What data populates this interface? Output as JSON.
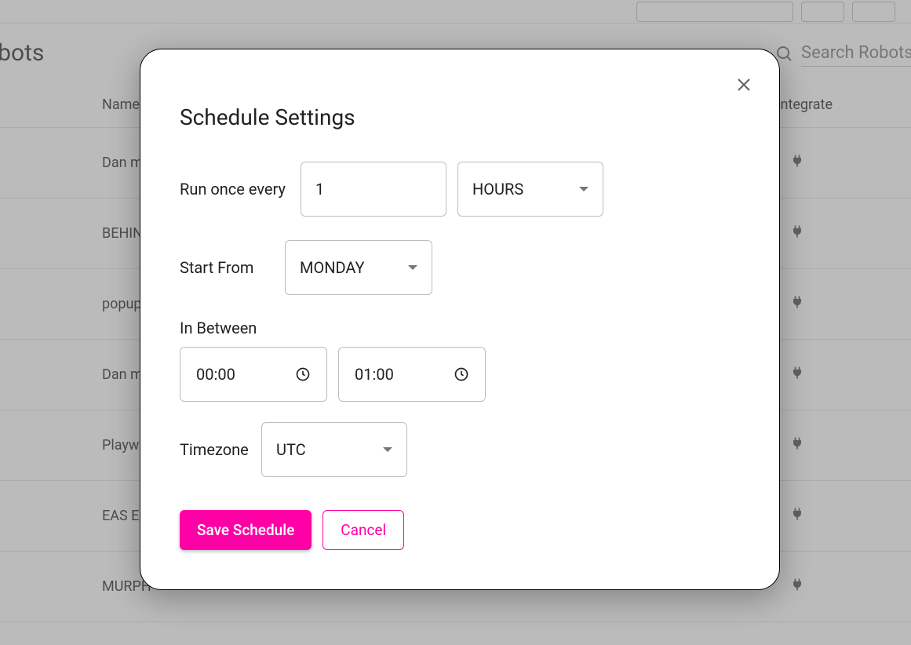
{
  "page": {
    "title": "obots",
    "search_placeholder": "Search Robots",
    "columns": {
      "name": "Name",
      "integrate": "ntegrate"
    },
    "rows": [
      {
        "name": "Dan m"
      },
      {
        "name": "BEHIN"
      },
      {
        "name": "popup"
      },
      {
        "name": "Dan m"
      },
      {
        "name": "Playw"
      },
      {
        "name": "EAS E"
      },
      {
        "name": "MURPH"
      }
    ]
  },
  "modal": {
    "title": "Schedule Settings",
    "run_once_every_label": "Run once every",
    "interval_value": "1",
    "interval_unit": "HOURS",
    "start_from_label": "Start From",
    "start_from_value": "MONDAY",
    "in_between_label": "In Between",
    "time_start": "00:00",
    "time_end": "01:00",
    "timezone_label": "Timezone",
    "timezone_value": "UTC",
    "save_label": "Save Schedule",
    "cancel_label": "Cancel"
  },
  "colors": {
    "accent": "#ff00a6"
  }
}
